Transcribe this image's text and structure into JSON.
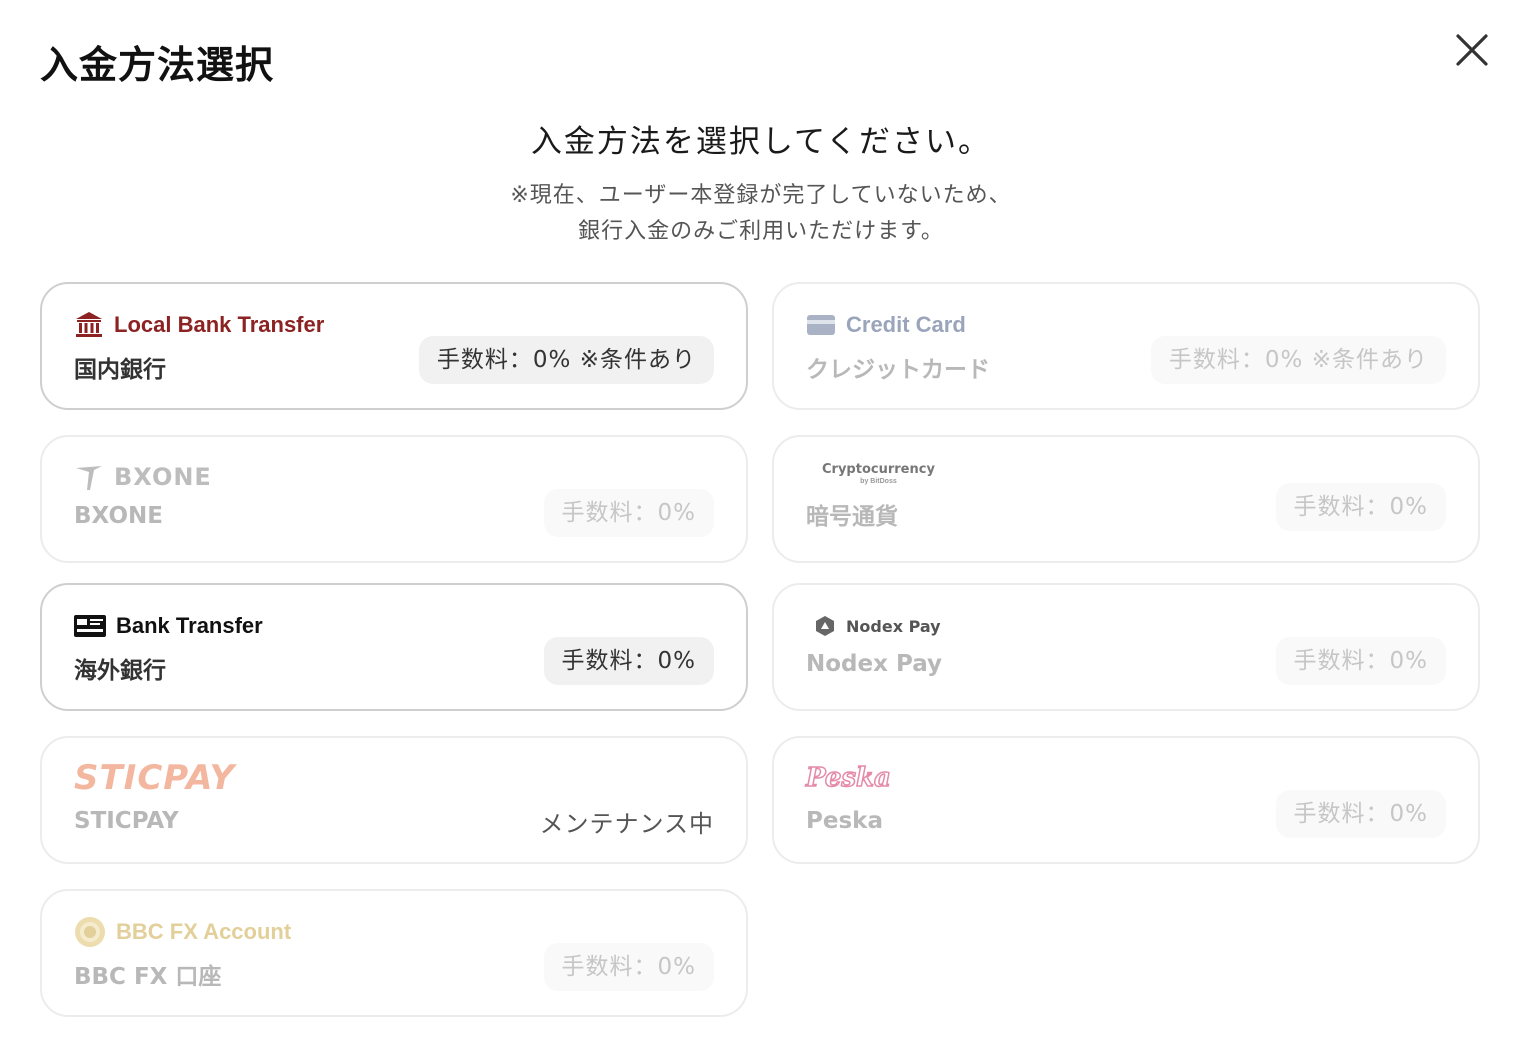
{
  "modal": {
    "title": "入金方法選択",
    "lead": "入金方法を選択してください。",
    "note_line1": "※現在、ユーザー本登録が完了していないため、",
    "note_line2": "銀行入金のみご利用いただけます。"
  },
  "methods": [
    {
      "brand": "Local Bank Transfer",
      "label": "国内銀行",
      "fee": "手数料：0% ※条件あり",
      "icon": "bank-building-icon",
      "enabled": true
    },
    {
      "brand": "Credit Card",
      "label": "クレジットカード",
      "fee": "手数料：0% ※条件あり",
      "icon": "credit-card-icon",
      "enabled": false
    },
    {
      "brand": "BXONE",
      "label": "BXONE",
      "fee": "手数料：0%",
      "icon": "bxone-logo",
      "enabled": false
    },
    {
      "brand_line1": "Cryptocurrency",
      "brand_line2": "by BitDoss",
      "label": "暗号通貨",
      "fee": "手数料：0%",
      "icon": "cryptocurrency-logo",
      "enabled": false
    },
    {
      "brand": "Bank Transfer",
      "label": "海外銀行",
      "fee": "手数料：0%",
      "icon": "bank-card-icon",
      "enabled": true
    },
    {
      "brand": "Nodex Pay",
      "label": "Nodex Pay",
      "fee": "手数料：0%",
      "icon": "nodex-logo",
      "enabled": false
    },
    {
      "brand": "STICPAY",
      "label": "STICPAY",
      "status": "メンテナンス中",
      "icon": "sticpay-logo",
      "enabled": false
    },
    {
      "brand": "Peska",
      "label": "Peska",
      "fee": "手数料：0%",
      "icon": "peska-logo",
      "enabled": false
    },
    {
      "brand": "BBC FX Account",
      "label": "BBC FX 口座",
      "fee": "手数料：0%",
      "icon": "bbc-coin-icon",
      "enabled": false
    }
  ],
  "colors": {
    "local_bank_brand": "#8c2222",
    "credit_card_brand": "#9aa5bb",
    "sticpay_brand": "#f3b7a0",
    "peska_brand": "#e58aa9",
    "bbc_brand": "#e2cf9a"
  }
}
